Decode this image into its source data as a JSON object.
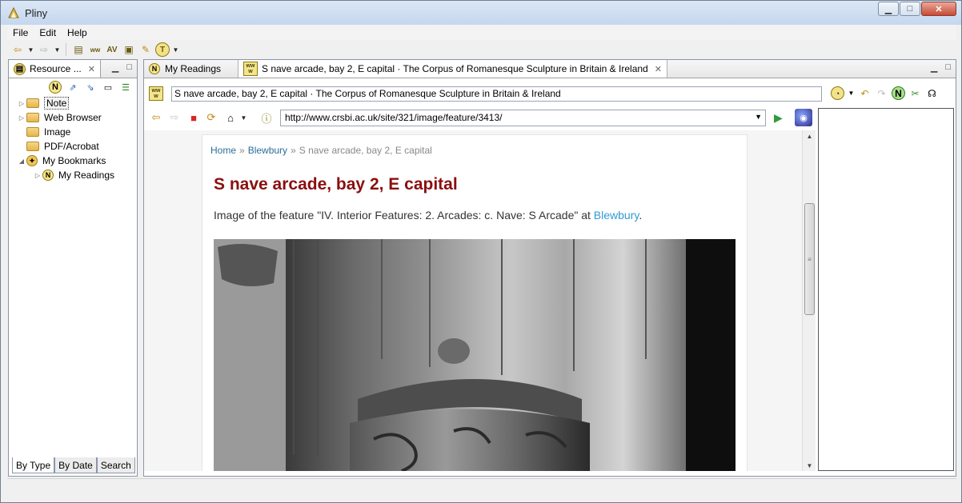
{
  "window": {
    "title": "Pliny",
    "minimize": "▁",
    "maximize": "□",
    "close": "✕"
  },
  "menu": [
    "File",
    "Edit",
    "Help"
  ],
  "left_panel": {
    "tab_label": "Resource ...",
    "tree": [
      {
        "label": "Note",
        "icon": "folder-open-icon",
        "expandable": true,
        "selected": true
      },
      {
        "label": "Web Browser",
        "icon": "folder-icon",
        "expandable": true
      },
      {
        "label": "Image",
        "icon": "folder-icon",
        "expandable": false
      },
      {
        "label": "PDF/Acrobat",
        "icon": "folder-icon",
        "expandable": false
      },
      {
        "label": "My Bookmarks",
        "icon": "bookmarks-icon",
        "expandable": true,
        "expanded": true
      },
      {
        "label": "My Readings",
        "icon": "note-n-icon",
        "expandable": true,
        "indent": 1
      }
    ],
    "bottom_tabs": [
      "By Type",
      "By Date",
      "Search"
    ],
    "active_bottom_tab": "By Type"
  },
  "main_panel": {
    "tabs": [
      {
        "label": "My Readings",
        "icon": "N"
      },
      {
        "label": "S nave arcade, bay 2, E capital · The Corpus of Romanesque Sculpture in Britain & Ireland",
        "icon": "www"
      }
    ],
    "page_title_field": "S nave arcade, bay 2, E capital · The Corpus of Romanesque Sculpture in Britain & Ireland",
    "url": "http://www.crsbi.ac.uk/site/321/image/feature/3413/"
  },
  "web_page": {
    "breadcrumb": {
      "home": "Home",
      "site": "Blewbury",
      "current": "S nave arcade, bay 2, E capital"
    },
    "heading": "S nave arcade, bay 2, E capital",
    "desc_prefix": "Image of the feature \"IV. Interior Features: 2. Arcades: c. Nave: S Arcade\" at ",
    "desc_link": "Blewbury",
    "desc_suffix": "."
  },
  "colors": {
    "heading": "#8a0f0f",
    "link": "#2f9bd6",
    "breadcrumb_link": "#2c6e9a"
  }
}
